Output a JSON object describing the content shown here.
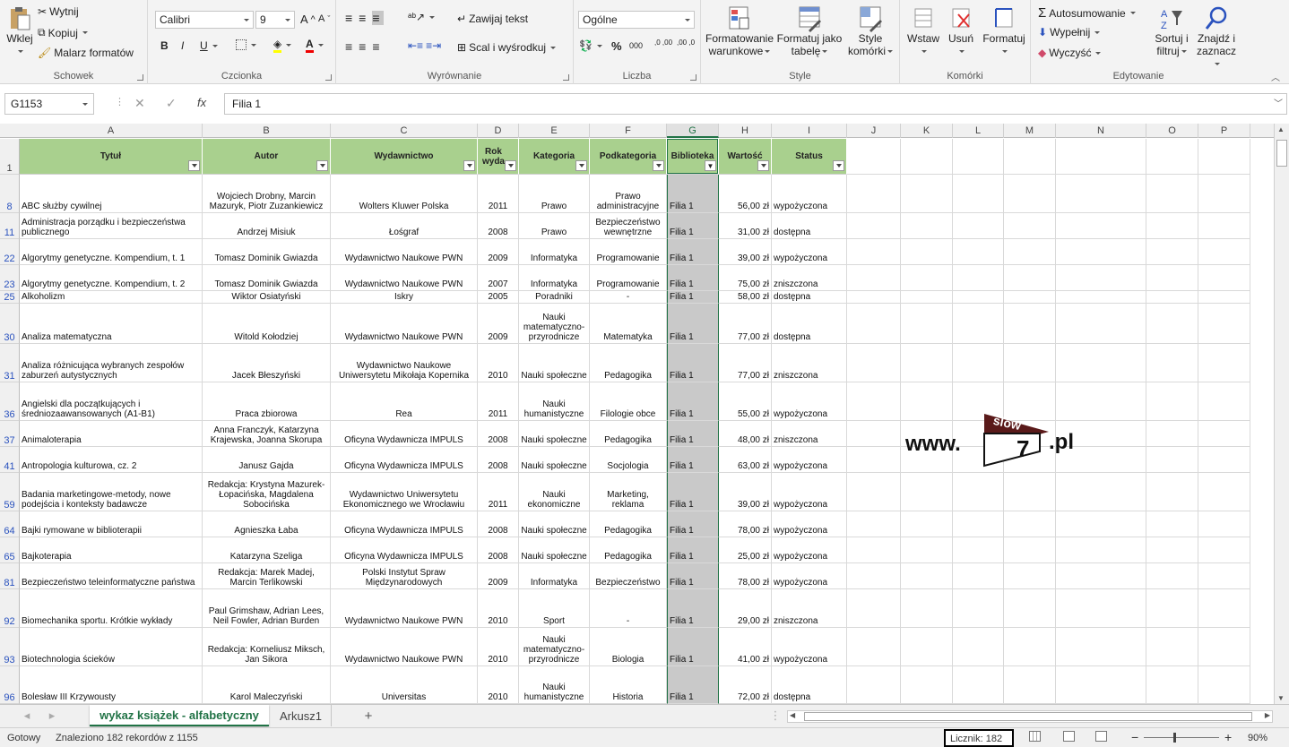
{
  "ribbon": {
    "clipboard": {
      "paste": "Wklej",
      "cut": "Wytnij",
      "copy": "Kopiuj",
      "format_painter": "Malarz formatów",
      "label": "Schowek"
    },
    "font": {
      "name": "Calibri",
      "size": "9",
      "bold": "B",
      "italic": "I",
      "underline": "U",
      "grow": "A",
      "shrink": "A",
      "color_letter": "A",
      "label": "Czcionka"
    },
    "alignment": {
      "wrap": "Zawijaj tekst",
      "merge": "Scal i wyśrodkuj",
      "label": "Wyrównanie"
    },
    "number": {
      "format": "Ogólne",
      "percent": "%",
      "thousands": "000",
      "inc": ",0 ,00",
      "dec": ",00 ,0",
      "label": "Liczba"
    },
    "styles": {
      "conditional": [
        "Formatowanie",
        "warunkowe"
      ],
      "table": [
        "Formatuj jako",
        "tabelę"
      ],
      "cell_styles": [
        "Style",
        "komórki"
      ],
      "label": "Style"
    },
    "cells": {
      "insert": "Wstaw",
      "delete": "Usuń",
      "format": "Formatuj",
      "label": "Komórki"
    },
    "editing": {
      "autosum": "Autosumowanie",
      "fill": "Wypełnij",
      "clear": "Wyczyść",
      "sort": [
        "Sortuj i",
        "filtruj"
      ],
      "find": [
        "Znajdź i",
        "zaznacz"
      ],
      "label": "Edytowanie"
    }
  },
  "formula_bar": {
    "name_box": "G1153",
    "fx": "fx",
    "value": "Filia 1"
  },
  "columns": [
    "A",
    "B",
    "C",
    "D",
    "E",
    "F",
    "G",
    "H",
    "I",
    "J",
    "K",
    "L",
    "M",
    "N",
    "O",
    "P"
  ],
  "header_row": {
    "row": "1",
    "cells": [
      "Tytuł",
      "Autor",
      "Wydawnictwo",
      "Rok wyda",
      "Kategoria",
      "Podkategoria",
      "Biblioteka",
      "Wartość",
      "Status"
    ]
  },
  "rows": [
    {
      "n": "8",
      "h": 43,
      "v": [
        "ABC służby cywilnej",
        "Wojciech Drobny, Marcin Mazuryk, Piotr Zuzankiewicz",
        "Wolters Kluwer Polska",
        "2011",
        "Prawo",
        "Prawo administracyjne",
        "Filia 1",
        "56,00 zł",
        "wypożyczona"
      ]
    },
    {
      "n": "11",
      "h": 29,
      "v": [
        "Administracja porządku i bezpieczeństwa publicznego",
        "Andrzej Misiuk",
        "Łośgraf",
        "2008",
        "Prawo",
        "Bezpieczeństwo wewnętrzne",
        "Filia 1",
        "31,00 zł",
        "dostępna"
      ]
    },
    {
      "n": "22",
      "h": 29,
      "v": [
        "Algorytmy genetyczne. Kompendium, t. 1",
        "Tomasz Dominik Gwiazda",
        "Wydawnictwo Naukowe PWN",
        "2009",
        "Informatyka",
        "Programowanie",
        "Filia 1",
        "39,00 zł",
        "wypożyczona"
      ]
    },
    {
      "n": "23",
      "h": 29,
      "v": [
        "Algorytmy genetyczne. Kompendium, t. 2",
        "Tomasz Dominik Gwiazda",
        "Wydawnictwo Naukowe PWN",
        "2007",
        "Informatyka",
        "Programowanie",
        "Filia 1",
        "75,00 zł",
        "zniszczona"
      ]
    },
    {
      "n": "25",
      "h": 14,
      "v": [
        "Alkoholizm",
        "Wiktor Osiatyński",
        "Iskry",
        "2005",
        "Poradniki",
        "-",
        "Filia 1",
        "58,00 zł",
        "dostępna"
      ]
    },
    {
      "n": "30",
      "h": 45,
      "v": [
        "Analiza matematyczna",
        "Witold Kołodziej",
        "Wydawnictwo Naukowe PWN",
        "2009",
        "Nauki matematyczno-przyrodnicze",
        "Matematyka",
        "Filia 1",
        "77,00 zł",
        "dostępna"
      ]
    },
    {
      "n": "31",
      "h": 43,
      "v": [
        "Analiza różnicująca wybranych zespołów zaburzeń autystycznych",
        "Jacek Błeszyński",
        "Wydawnictwo Naukowe Uniwersytetu Mikołaja Kopernika",
        "2010",
        "Nauki społeczne",
        "Pedagogika",
        "Filia 1",
        "77,00 zł",
        "zniszczona"
      ]
    },
    {
      "n": "36",
      "h": 43,
      "v": [
        "Angielski dla początkujących i średniozaawansowanych (A1-B1)",
        "Praca zbiorowa",
        "Rea",
        "2011",
        "Nauki humanistyczne",
        "Filologie obce",
        "Filia 1",
        "55,00 zł",
        "wypożyczona"
      ]
    },
    {
      "n": "37",
      "h": 29,
      "v": [
        "Animaloterapia",
        "Anna Franczyk, Katarzyna Krajewska, Joanna Skorupa",
        "Oficyna Wydawnicza IMPULS",
        "2008",
        "Nauki społeczne",
        "Pedagogika",
        "Filia 1",
        "48,00 zł",
        "zniszczona"
      ]
    },
    {
      "n": "41",
      "h": 29,
      "v": [
        "Antropologia kulturowa, cz. 2",
        "Janusz Gajda",
        "Oficyna Wydawnicza IMPULS",
        "2008",
        "Nauki społeczne",
        "Socjologia",
        "Filia 1",
        "63,00 zł",
        "wypożyczona"
      ]
    },
    {
      "n": "59",
      "h": 43,
      "v": [
        "Badania marketingowe-metody, nowe podejścia i konteksty badawcze",
        "Redakcja: Krystyna Mazurek-Łopacińska, Magdalena Sobocińska",
        "Wydawnictwo Uniwersytetu Ekonomicznego we Wrocławiu",
        "2011",
        "Nauki ekonomiczne",
        "Marketing, reklama",
        "Filia 1",
        "39,00 zł",
        "wypożyczona"
      ]
    },
    {
      "n": "64",
      "h": 29,
      "v": [
        "Bajki rymowane w biblioterapii",
        "Agnieszka Łaba",
        "Oficyna Wydawnicza IMPULS",
        "2008",
        "Nauki społeczne",
        "Pedagogika",
        "Filia 1",
        "78,00 zł",
        "wypożyczona"
      ]
    },
    {
      "n": "65",
      "h": 29,
      "v": [
        "Bajkoterapia",
        "Katarzyna Szeliga",
        "Oficyna Wydawnicza IMPULS",
        "2008",
        "Nauki społeczne",
        "Pedagogika",
        "Filia 1",
        "25,00 zł",
        "wypożyczona"
      ]
    },
    {
      "n": "81",
      "h": 29,
      "v": [
        "Bezpieczeństwo teleinformatyczne państwa",
        "Redakcja: Marek Madej, Marcin Terlikowski",
        "Polski Instytut Spraw Międzynarodowych",
        "2009",
        "Informatyka",
        "Bezpieczeństwo",
        "Filia 1",
        "78,00 zł",
        "wypożyczona"
      ]
    },
    {
      "n": "92",
      "h": 43,
      "v": [
        "Biomechanika sportu. Krótkie wykłady",
        "Paul Grimshaw, Adrian Lees, Neil Fowler, Adrian Burden",
        "Wydawnictwo Naukowe PWN",
        "2010",
        "Sport",
        "-",
        "Filia 1",
        "29,00 zł",
        "zniszczona"
      ]
    },
    {
      "n": "93",
      "h": 43,
      "v": [
        "Biotechnologia ścieków",
        "Redakcja: Korneliusz Miksch, Jan Sikora",
        "Wydawnictwo Naukowe PWN",
        "2010",
        "Nauki matematyczno-przyrodnicze",
        "Biologia",
        "Filia 1",
        "41,00 zł",
        "wypożyczona"
      ]
    },
    {
      "n": "96",
      "h": 43,
      "v": [
        "Bolesław III Krzywousty",
        "Karol Maleczyński",
        "Universitas",
        "2010",
        "Nauki humanistyczne",
        "Historia",
        "Filia 1",
        "72,00 zł",
        "dostępna"
      ]
    }
  ],
  "logo": {
    "prefix": "www.",
    "flag": "slow",
    "num": "7",
    "suffix": ".pl"
  },
  "sheets": {
    "active": "wykaz książek - alfabetyczny",
    "other": "Arkusz1",
    "add": "+"
  },
  "status": {
    "ready": "Gotowy",
    "found": "Znaleziono 182 rekordów z 1155",
    "count": "Licznik: 182",
    "zoom": "90%",
    "minus": "−",
    "plus": "+"
  }
}
